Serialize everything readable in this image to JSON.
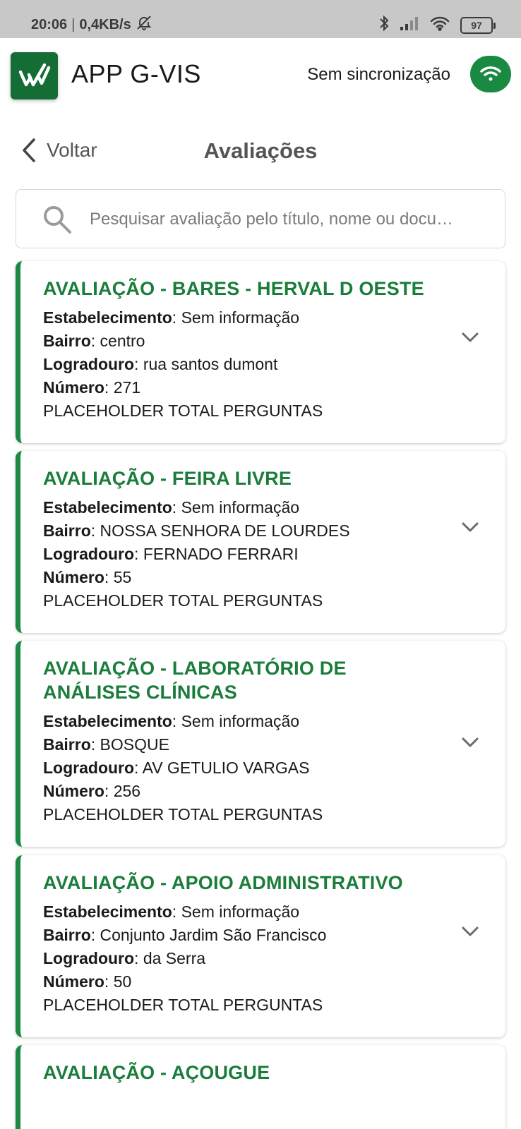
{
  "status_bar": {
    "time": "20:06",
    "speed": "0,4KB/s",
    "battery": "97"
  },
  "header": {
    "app_title": "APP G-VIS",
    "sync_status": "Sem sincronização"
  },
  "nav": {
    "back_label": "Voltar",
    "page_title": "Avaliações"
  },
  "search": {
    "placeholder": "Pesquisar avaliação pelo título, nome ou docu…"
  },
  "labels": {
    "establishment": "Estabelecimento",
    "neighborhood": "Bairro",
    "street": "Logradouro",
    "number": "Número"
  },
  "evaluations": [
    {
      "title": "AVALIAÇÃO - BARES - HERVAL D OESTE",
      "establishment": "Sem informação",
      "neighborhood": "centro",
      "street": "rua santos dumont",
      "number": "271",
      "total_questions": "PLACEHOLDER TOTAL PERGUNTAS"
    },
    {
      "title": "AVALIAÇÃO - FEIRA LIVRE",
      "establishment": "Sem informação",
      "neighborhood": "NOSSA SENHORA DE LOURDES",
      "street": "FERNADO FERRARI",
      "number": "55",
      "total_questions": "PLACEHOLDER TOTAL PERGUNTAS"
    },
    {
      "title": "AVALIAÇÃO - LABORATÓRIO DE ANÁLISES CLÍNICAS",
      "establishment": "Sem informação",
      "neighborhood": "BOSQUE",
      "street": "AV GETULIO VARGAS",
      "number": "256",
      "total_questions": "PLACEHOLDER TOTAL PERGUNTAS"
    },
    {
      "title": "AVALIAÇÃO - APOIO ADMINISTRATIVO",
      "establishment": "Sem informação",
      "neighborhood": "Conjunto Jardim São Francisco",
      "street": "da Serra",
      "number": "50",
      "total_questions": "PLACEHOLDER TOTAL PERGUNTAS"
    },
    {
      "title": "AVALIAÇÃO - AÇOUGUE"
    }
  ],
  "colors": {
    "brand_green": "#1a8a43",
    "title_green": "#1a7d3b",
    "status_bar": "#c8c8c8"
  },
  "icons": [
    "bell-off-icon",
    "bluetooth-icon",
    "signal-icon",
    "wifi-icon",
    "battery-icon",
    "app-logo-icon",
    "sync-wifi-icon",
    "back-chevron-icon",
    "search-icon",
    "chevron-down-icon"
  ]
}
